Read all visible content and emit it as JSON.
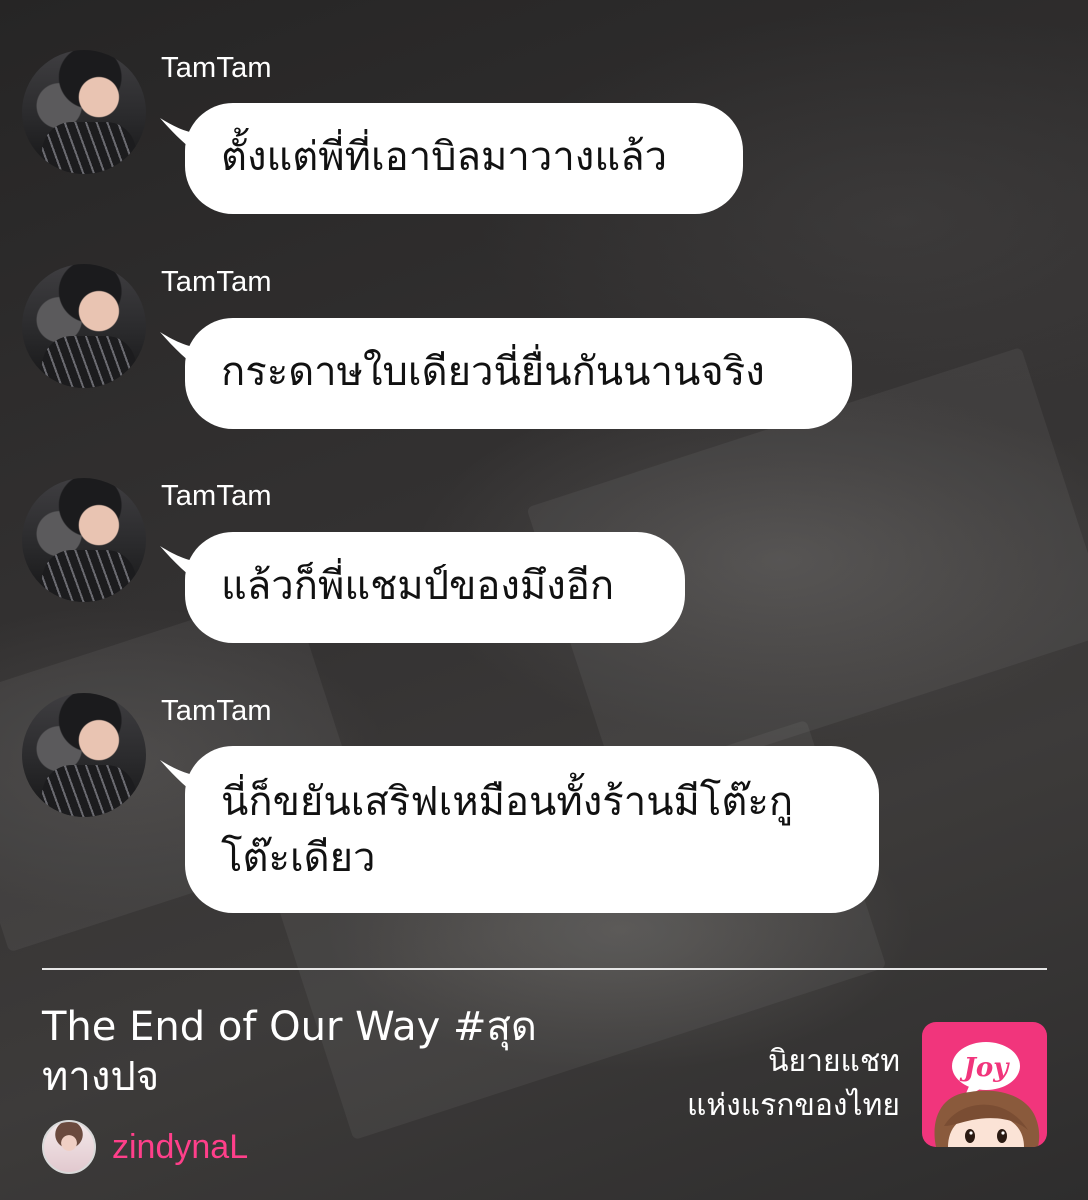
{
  "messages": [
    {
      "sender": "TamTam",
      "text": "ตั้งแต่พี่ที่เอาบิลมาวางแล้ว"
    },
    {
      "sender": "TamTam",
      "text": "กระดาษใบเดียวนี่ยื่นกันนานจริง"
    },
    {
      "sender": "TamTam",
      "text": "แล้วก็พี่แชมป์ของมึงอีก"
    },
    {
      "sender": "TamTam",
      "text": "นี่ก็ขยันเสริฟเหมือนทั้งร้านมีโต๊ะกู โต๊ะเดียว"
    }
  ],
  "footer": {
    "title": "The End of Our Way  #สุด ทางปจ",
    "author": "zindynaL",
    "tagline_line1": "นิยายแชท",
    "tagline_line2": "แห่งแรกของไทย",
    "logo_text": "Joy"
  },
  "colors": {
    "accent": "#ff3f8a",
    "logo_bg": "#f1357c",
    "bubble": "#ffffff",
    "text_light": "#ffffff"
  }
}
